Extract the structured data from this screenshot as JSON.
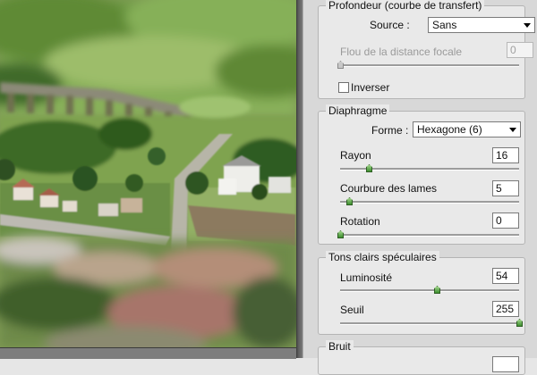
{
  "depth_group": {
    "title": "Profondeur (courbe de transfert)",
    "source_label": "Source :",
    "source_value": "Sans",
    "blur_focal_label": "Flou de la distance focale",
    "blur_focal_value": "0",
    "blur_focal_slider": 0,
    "invert_label": "Inverser",
    "invert_checked": false
  },
  "iris_group": {
    "title": "Diaphragme",
    "shape_label": "Forme :",
    "shape_value": "Hexagone (6)",
    "radius_label": "Rayon",
    "radius_value": "16",
    "radius_slider": 0.16,
    "blade_curvature_label": "Courbure des lames",
    "blade_curvature_value": "5",
    "blade_curvature_slider": 0.05,
    "rotation_label": "Rotation",
    "rotation_value": "0",
    "rotation_slider": 0
  },
  "specular_group": {
    "title": "Tons clairs spéculaires",
    "brightness_label": "Luminosité",
    "brightness_value": "54",
    "brightness_slider": 0.54,
    "threshold_label": "Seuil",
    "threshold_value": "255",
    "threshold_slider": 1.0
  },
  "noise_group": {
    "title": "Bruit"
  },
  "colors": {
    "slider_thumb": "#4a9a3a",
    "panel_bg": "#d8d8d8"
  }
}
